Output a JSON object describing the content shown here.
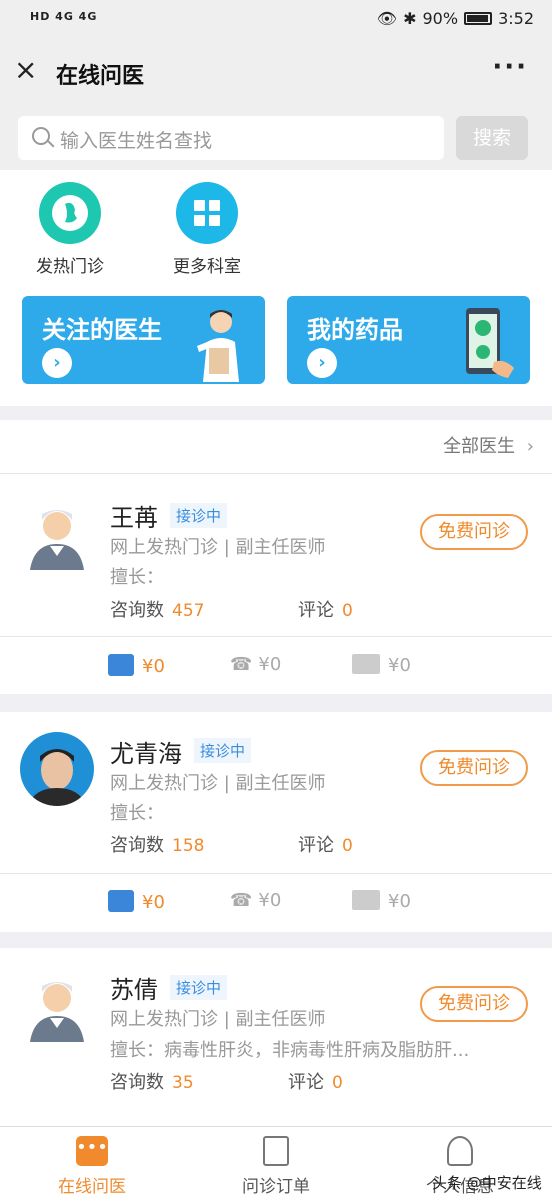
{
  "status": {
    "left": "HD 4G 4G",
    "battery": "90%",
    "time": "3:52"
  },
  "nav": {
    "title": "在线问医",
    "close": "×",
    "more": "···"
  },
  "search": {
    "placeholder": "输入医生姓名查找",
    "button": "搜索"
  },
  "quick": [
    {
      "label": "发热门诊"
    },
    {
      "label": "更多科室"
    }
  ],
  "banners": [
    {
      "title": "关注的医生"
    },
    {
      "title": "我的药品"
    }
  ],
  "all_doctors": "全部医生",
  "doctors": [
    {
      "name": "王苒",
      "status": "接诊中",
      "dept": "网上发热门诊 | 副主任医师",
      "specialty": "擅长：",
      "consult_label": "咨询数",
      "consult": "457",
      "review_label": "评论",
      "review": "0",
      "free": "免费问诊",
      "prices": [
        "¥0",
        "¥0",
        "¥0"
      ]
    },
    {
      "name": "尤青海",
      "status": "接诊中",
      "dept": "网上发热门诊 | 副主任医师",
      "specialty": "擅长：",
      "consult_label": "咨询数",
      "consult": "158",
      "review_label": "评论",
      "review": "0",
      "free": "免费问诊",
      "prices": [
        "¥0",
        "¥0",
        "¥0"
      ]
    },
    {
      "name": "苏倩",
      "status": "接诊中",
      "dept": "网上发热门诊 | 副主任医师",
      "specialty": "擅长：病毒性肝炎，非病毒性肝病及脂肪肝...",
      "consult_label": "咨询数",
      "consult": "35",
      "review_label": "评论",
      "review": "0",
      "free": "免费问诊"
    }
  ],
  "tabs": [
    {
      "label": "在线问医"
    },
    {
      "label": "问诊订单"
    },
    {
      "label": "个人信息"
    }
  ],
  "watermark": "头条 @中安在线",
  "colors": {
    "accent": "#f08a2c",
    "blue": "#2ea9ea",
    "teal": "#1ec8b0"
  }
}
